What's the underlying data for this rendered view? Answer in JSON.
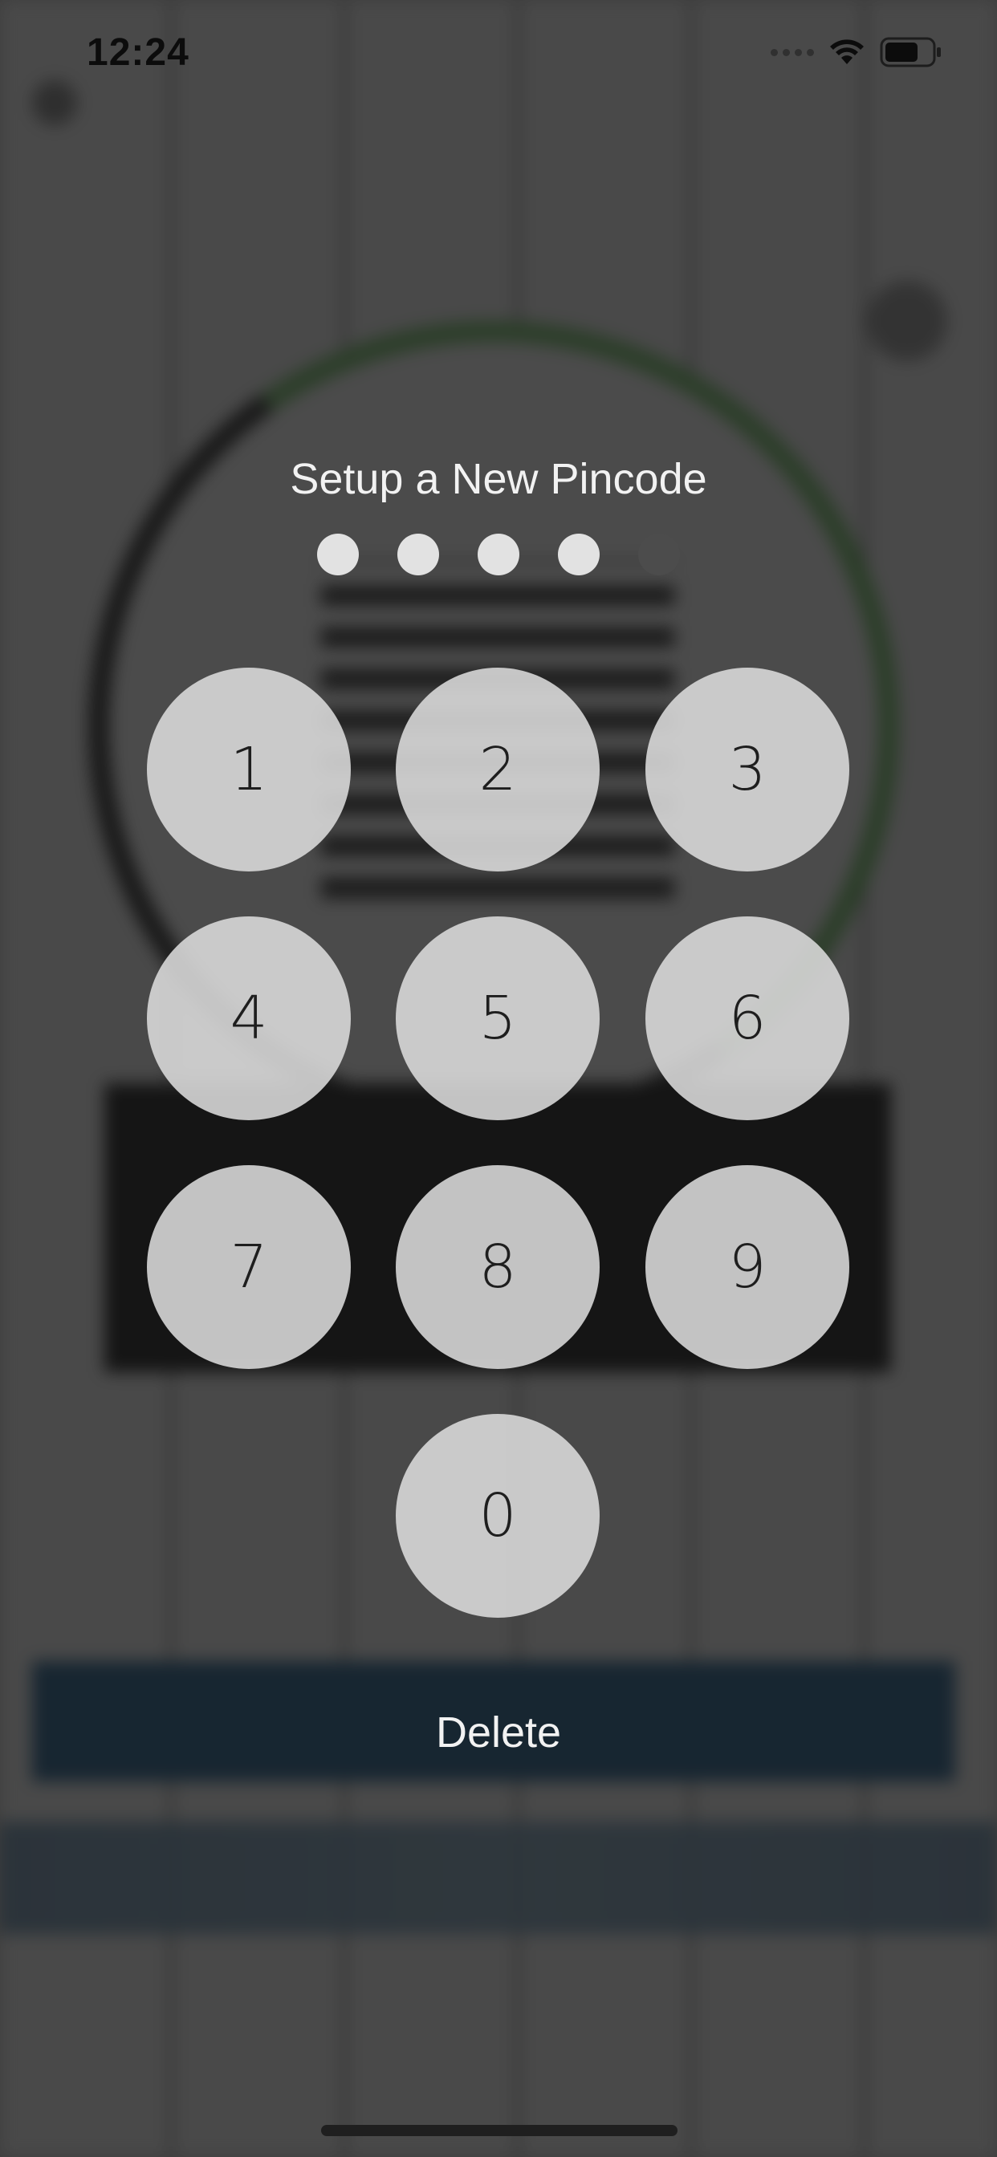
{
  "status_bar": {
    "time": "12:24",
    "icons": [
      "cellular-signal-icon",
      "wifi-icon",
      "battery-icon"
    ]
  },
  "pincode": {
    "title": "Setup a New Pincode",
    "length": 5,
    "entered_count": 4
  },
  "keypad": {
    "keys": [
      "1",
      "2",
      "3",
      "4",
      "5",
      "6",
      "7",
      "8",
      "9",
      "0"
    ],
    "delete_label": "Delete"
  },
  "colors": {
    "overlay": "#4a4a4a",
    "key_background": "#dcdcdc",
    "dot_filled": "#e2e2e2",
    "dot_empty": "#4c4c4c",
    "text_light": "#f2f2f2"
  }
}
